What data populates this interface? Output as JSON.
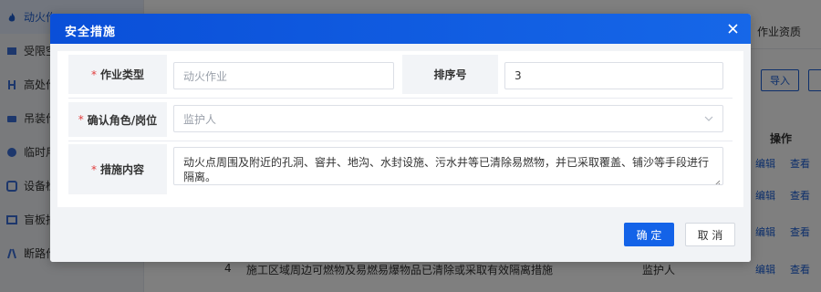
{
  "background": {
    "sidebar": {
      "items": [
        {
          "label": "动火作",
          "icon": "fire-icon",
          "active": true
        },
        {
          "label": "受限空",
          "icon": "box-icon",
          "active": false
        },
        {
          "label": "高处作",
          "icon": "ladder-icon",
          "active": false
        },
        {
          "label": "吊装作",
          "icon": "crane-icon",
          "active": false
        },
        {
          "label": "临时用",
          "icon": "power-icon",
          "active": false
        },
        {
          "label": "设备检",
          "icon": "device-icon",
          "active": false
        },
        {
          "label": "盲板抽",
          "icon": "plate-icon",
          "active": false
        },
        {
          "label": "断路作业",
          "icon": "road-icon",
          "active": false
        }
      ]
    },
    "tabs": {
      "qualification": "作业资质"
    },
    "toolbar": {
      "import_label": "导入"
    },
    "table": {
      "operation_header": "操作",
      "row_number": "4",
      "row_text": "施工区域周边可燃物及易燃易爆物品已清除或采取有效隔离措施",
      "row_role": "监护人",
      "edit_label": "编辑",
      "view_label": "查看"
    }
  },
  "dialog": {
    "title": "安全措施",
    "form": {
      "work_type": {
        "label": "作业类型",
        "value": "动火作业"
      },
      "order_no": {
        "label": "排序号",
        "value": "3"
      },
      "role": {
        "label": "确认角色/岗位",
        "value": "监护人"
      },
      "measure": {
        "label": "措施内容",
        "value": "动火点周围及附近的孔洞、窨井、地沟、水封设施、污水井等已清除易燃物，并已采取覆盖、铺沙等手段进行隔离。"
      }
    },
    "buttons": {
      "confirm": "确 定",
      "cancel": "取 消"
    }
  },
  "colors": {
    "header_blue": "#1463e8",
    "required_red": "#e23c3c",
    "link_blue": "#1a5fd6"
  }
}
